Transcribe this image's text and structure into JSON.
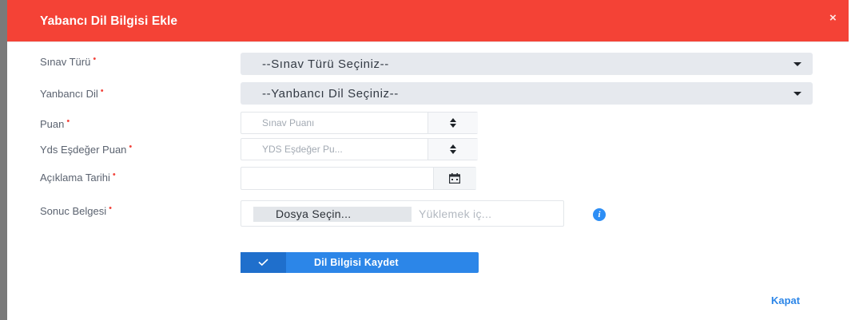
{
  "modal": {
    "title": "Yabancı Dil Bilgisi Ekle",
    "close_glyph": "×"
  },
  "form": {
    "required_marker": "•",
    "sinav_turu": {
      "label": "Sınav Türü",
      "value": "--Sınav Türü Seçiniz--"
    },
    "yabanci_dil": {
      "label": "Yanbancı Dil",
      "value": "--Yanbancı Dil Seçiniz--"
    },
    "puan": {
      "label": "Puan",
      "placeholder": "Sınav Puanı"
    },
    "yds_puan": {
      "label": "Yds Eşdeğer Puan",
      "placeholder": "YDS Eşdeğer Pu..."
    },
    "aciklama_tarihi": {
      "label": "Açıklama Tarihi"
    },
    "sonuc_belgesi": {
      "label": "Sonuc Belgesi",
      "button_label": "Dosya Seçin...",
      "placeholder": "Yüklemek iç..."
    },
    "info_glyph": "i"
  },
  "actions": {
    "save_label": "Dil Bilgisi Kaydet",
    "close_label": "Kapat"
  },
  "colors": {
    "header": "#f44236",
    "primary": "#2c86e8",
    "required": "#f2453d"
  }
}
